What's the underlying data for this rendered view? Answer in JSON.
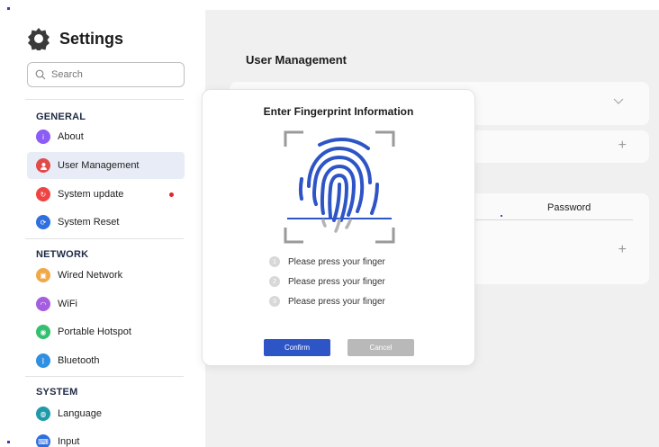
{
  "sidebar": {
    "title": "Settings",
    "search_placeholder": "Search",
    "sections": [
      {
        "title": "GENERAL",
        "items": [
          {
            "label": "About",
            "icon": "info-icon",
            "color": "#8b5cf6"
          },
          {
            "label": "User Management",
            "icon": "user-icon",
            "color": "#e24a4a",
            "active": true
          },
          {
            "label": "System update",
            "icon": "update-icon",
            "color": "#ef4444",
            "badge": true
          },
          {
            "label": "System Reset",
            "icon": "reset-icon",
            "color": "#2f6fe0"
          }
        ]
      },
      {
        "title": "NETWORK",
        "items": [
          {
            "label": "Wired Network",
            "icon": "ethernet-icon",
            "color": "#f0a848"
          },
          {
            "label": "WiFi",
            "icon": "wifi-icon",
            "color": "#a55ee0"
          },
          {
            "label": "Portable Hotspot",
            "icon": "hotspot-icon",
            "color": "#34c06e"
          },
          {
            "label": "Bluetooth",
            "icon": "bluetooth-icon",
            "color": "#2f8fe0"
          }
        ]
      },
      {
        "title": "SYSTEM",
        "items": [
          {
            "label": "Language",
            "icon": "language-icon",
            "color": "#1f9aa8"
          },
          {
            "label": "Input",
            "icon": "keyboard-icon",
            "color": "#2f6fe0"
          }
        ]
      }
    ]
  },
  "main": {
    "title": "User Management",
    "password_label": "Password"
  },
  "dialog": {
    "title": "Enter Fingerprint Information",
    "steps": [
      {
        "num": "1",
        "text": "Please press your finger"
      },
      {
        "num": "2",
        "text": "Please press your finger"
      },
      {
        "num": "3",
        "text": "Please press your finger"
      }
    ],
    "confirm_label": "Confirm",
    "cancel_label": "Cancel"
  },
  "colors": {
    "accent": "#2e55c6",
    "fingerprint": "#2e55c6",
    "main_bg": "#f0f0f0"
  }
}
